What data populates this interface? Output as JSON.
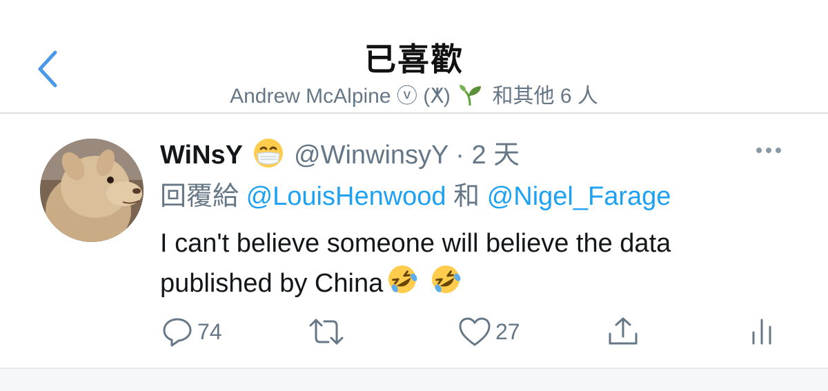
{
  "header": {
    "title": "已喜歡",
    "subtitle_name": "Andrew McAlpine ⓥ (ⵅ)",
    "subtitle_rest": "和其他 6 人"
  },
  "tweet": {
    "display_name": "WiNsY",
    "handle": "@WinwinsyY",
    "time": "· 2 天",
    "reply_prefix": "回覆給",
    "reply_mention_1": "@LouisHenwood",
    "reply_joiner": "和",
    "reply_mention_2": "@Nigel_Farage",
    "text_line1": "I can't believe someone will believe the data",
    "text_line2": "published by China",
    "reply_count": "74",
    "like_count": "27"
  },
  "colors": {
    "accent": "#1da1f2",
    "back_icon": "#4a98e8",
    "muted": "#657786"
  },
  "icons": [
    "chevron-left-icon",
    "sprout-emoji-icon",
    "face-mask-emoji-icon",
    "more-icon",
    "reply-icon",
    "retweet-icon",
    "like-icon",
    "share-icon",
    "analytics-icon",
    "rofl-emoji-icon"
  ]
}
